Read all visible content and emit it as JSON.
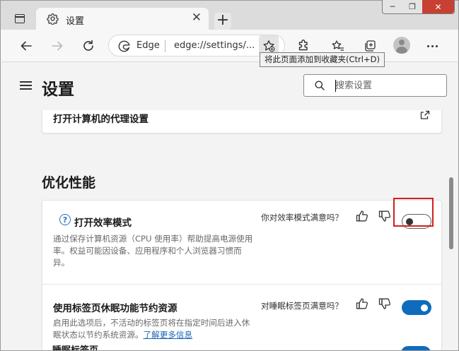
{
  "browser": {
    "tab": {
      "title": "设置"
    },
    "address_bar": {
      "site_label": "Edge",
      "url": "edge://settings/..."
    },
    "tooltip": "将此页面添加到收藏夹(Ctrl+D)",
    "window_controls": {
      "minimize": "─",
      "restore": "❐",
      "close": "✕"
    },
    "new_tab_label": "+"
  },
  "settings": {
    "title": "设置",
    "search": {
      "placeholder": "搜索设置",
      "value": ""
    },
    "proxy_link_label": "打开计算机的代理设置",
    "section_title": "优化性能",
    "items": [
      {
        "title": "打开效率模式",
        "description": "通过保存计算机资源（CPU 使用率）帮助提高电源使用率。权益可能因设备、应用程序和个人浏览器习惯而异。",
        "feedback_question": "你对效率模式满意吗？",
        "toggle_on": false,
        "help_icon": "?"
      },
      {
        "title": "使用标签页休眠功能节约资源",
        "description": "启用此选项后，不活动的标签页将在指定时间后进入休眠状态以节约系统资源。",
        "learn_more": "了解更多信息",
        "feedback_question": "对睡眠标签页满意吗？",
        "toggle_on": true
      }
    ],
    "next_item_partial_title": "睡眠标签页..."
  },
  "colors": {
    "accent": "#0f6cbd",
    "highlight_border": "#d21f1f",
    "link": "#1a66b8",
    "close_button": "#c84031"
  }
}
